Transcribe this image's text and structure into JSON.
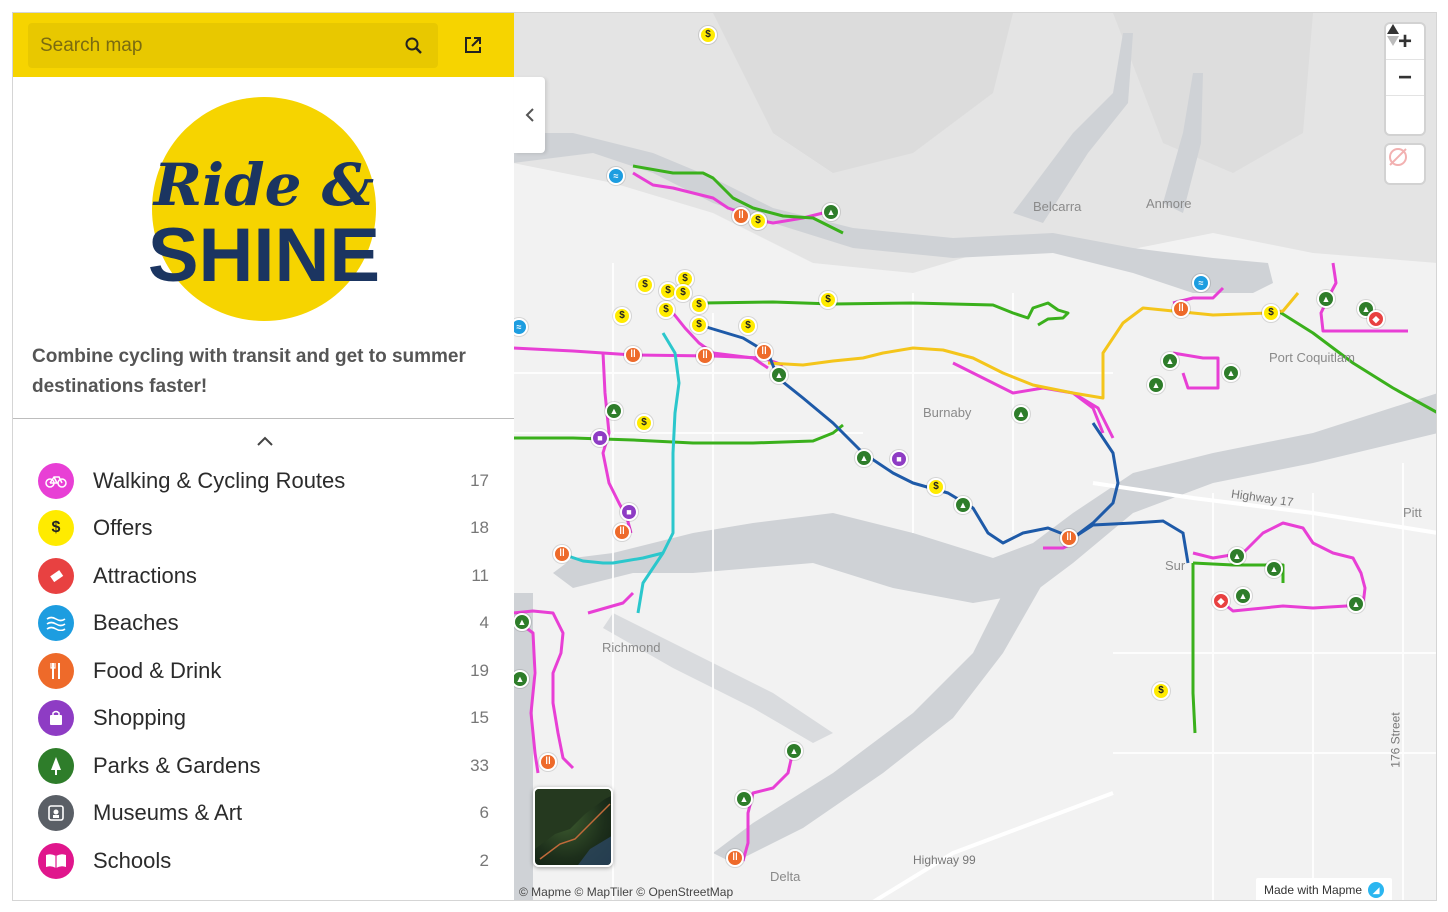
{
  "search": {
    "placeholder": "Search map"
  },
  "brand": {
    "logo_line1": "Ride &",
    "logo_line2": "SHINE",
    "tagline": "Combine cycling with transit and get to summer destinations faster!",
    "accent_color": "#f6d400",
    "navy_color": "#1b3561"
  },
  "categories": [
    {
      "label": "Walking & Cycling Routes",
      "count": "17",
      "icon": "bicycle-icon",
      "color": "#e83fd5"
    },
    {
      "label": "Offers",
      "count": "18",
      "icon": "dollar-icon",
      "color": "#ffeb00"
    },
    {
      "label": "Attractions",
      "count": "11",
      "icon": "ticket-icon",
      "color": "#e84141"
    },
    {
      "label": "Beaches",
      "count": "4",
      "icon": "waves-icon",
      "color": "#1d9de0"
    },
    {
      "label": "Food & Drink",
      "count": "19",
      "icon": "utensils-icon",
      "color": "#ee6a2a"
    },
    {
      "label": "Shopping",
      "count": "15",
      "icon": "shopping-bag-icon",
      "color": "#8e3cc4"
    },
    {
      "label": "Parks & Gardens",
      "count": "33",
      "icon": "tree-icon",
      "color": "#2e7d2a"
    },
    {
      "label": "Museums & Art",
      "count": "6",
      "icon": "museum-icon",
      "color": "#5a5f66"
    },
    {
      "label": "Schools",
      "count": "2",
      "icon": "book-icon",
      "color": "#e0168c"
    }
  ],
  "map": {
    "place_labels": [
      "Belcarra",
      "Anmore",
      "Burnaby",
      "Port Coquitlam",
      "Richmond",
      "Delta",
      "Pitt",
      "Sur"
    ],
    "road_labels": [
      "Highway 17",
      "Highway 99",
      "176 Street"
    ],
    "attribution": "© Mapme © MapTiler © OpenStreetMap",
    "made_with": "Made with Mapme",
    "zoom_in": "+",
    "zoom_out": "−",
    "offer_symbol": "$",
    "food_symbol": "ǀǀ",
    "park_symbol": "▲",
    "shop_symbol": "■",
    "beach_symbol": "≈",
    "attraction_symbol": "◆"
  }
}
